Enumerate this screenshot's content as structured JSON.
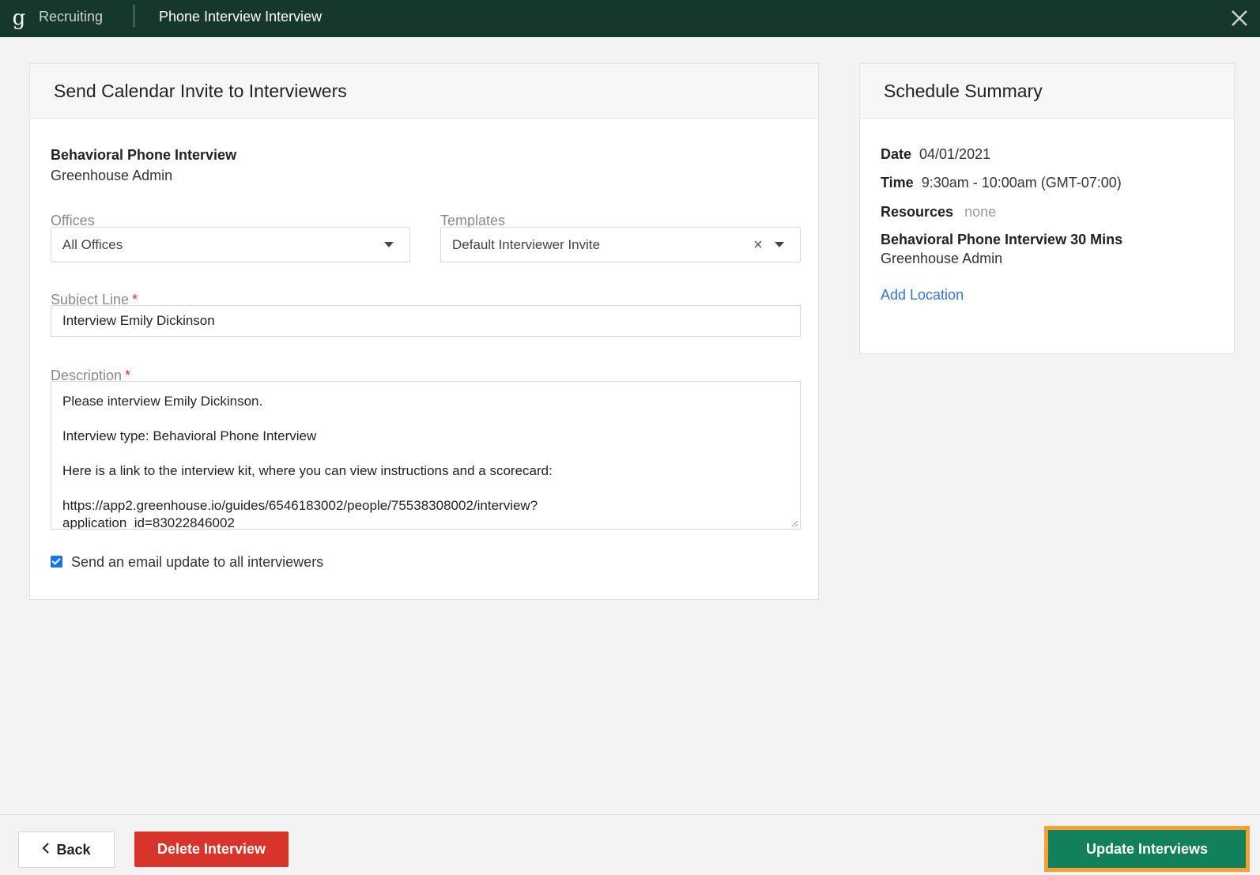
{
  "topbar": {
    "logo_glyph": "g",
    "brand": "Recruiting",
    "title": "Phone Interview Interview",
    "close_icon": "close-icon"
  },
  "invite": {
    "header": "Send Calendar Invite to Interviewers",
    "interview_name": "Behavioral Phone Interview",
    "interviewer": "Greenhouse Admin",
    "offices_label": "Offices",
    "offices_value": "All Offices",
    "templates_label": "Templates",
    "templates_value": "Default Interviewer Invite",
    "subject_label": "Subject Line",
    "subject_value": "Interview Emily Dickinson",
    "required_mark": "*",
    "description_label": "Description",
    "description_lines": [
      "Please interview Emily Dickinson.",
      "Interview type: Behavioral Phone Interview",
      "Here is a link to the interview kit, where you can view instructions and a scorecard:",
      "https://app2.greenhouse.io/guides/6546183002/people/75538308002/interview?\napplication_id=83022846002"
    ],
    "email_update_checked": true,
    "email_update_label": "Send an email update to all interviewers"
  },
  "summary": {
    "header": "Schedule Summary",
    "date_label": "Date",
    "date_value": "04/01/2021",
    "time_label": "Time",
    "time_value": "9:30am - 10:00am (GMT-07:00)",
    "resources_label": "Resources",
    "resources_value": "none",
    "interview_title": "Behavioral Phone Interview 30 Mins",
    "interviewer": "Greenhouse Admin",
    "add_location": "Add Location"
  },
  "footer": {
    "back_label": "Back",
    "delete_label": "Delete Interview",
    "update_label": "Update Interviews"
  },
  "colors": {
    "topbar": "#15372c",
    "delete": "#d9342b",
    "update": "#11805b",
    "focus_outline": "#f5a033",
    "link": "#3574d4"
  }
}
